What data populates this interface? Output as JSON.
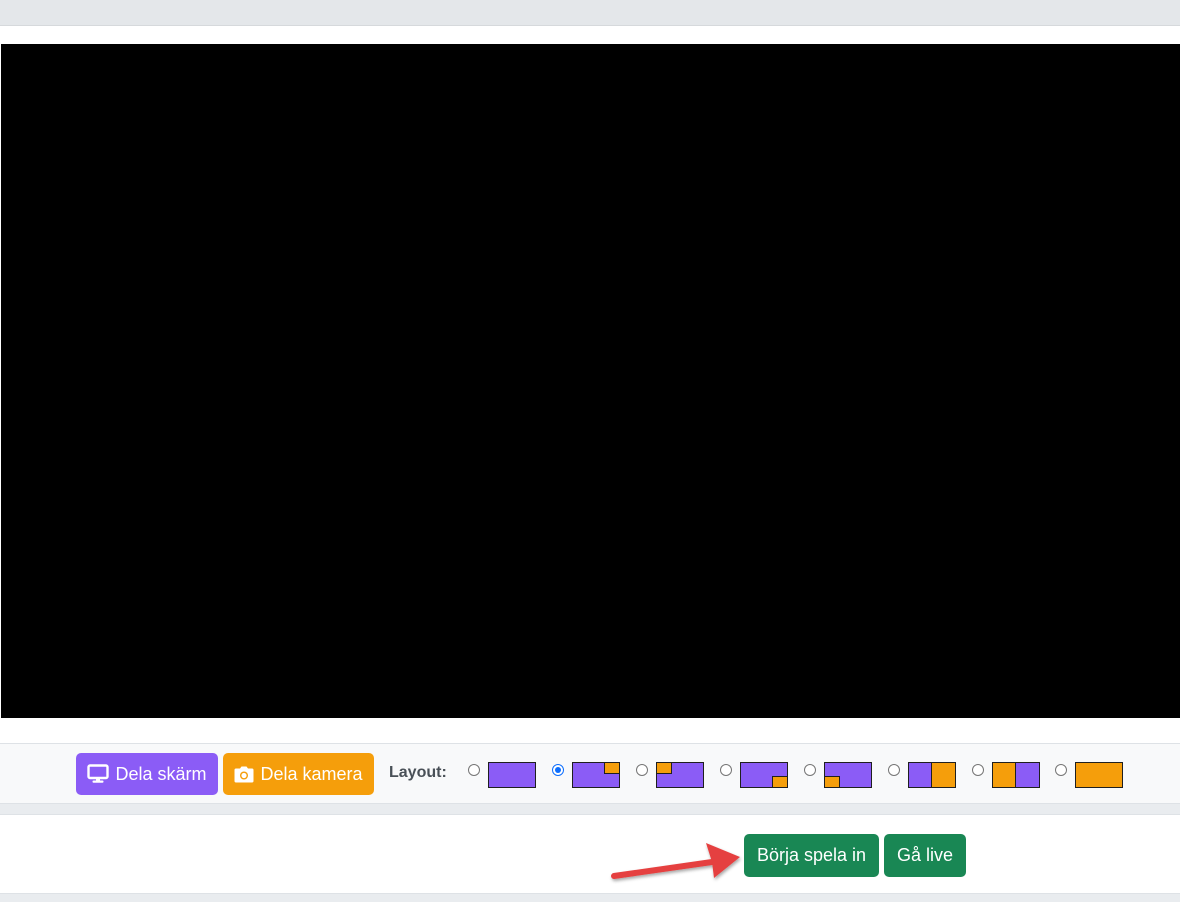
{
  "controls": {
    "share_screen_label": "Dela skärm",
    "share_camera_label": "Dela kamera",
    "layout_label": "Layout:",
    "layout_options": [
      {
        "id": "screen-only",
        "checked": false
      },
      {
        "id": "screen-camera-top-right",
        "checked": true
      },
      {
        "id": "screen-camera-top-left",
        "checked": false
      },
      {
        "id": "screen-camera-bottom-right",
        "checked": false
      },
      {
        "id": "screen-camera-bottom-left",
        "checked": false
      },
      {
        "id": "split-screen-left-camera-right",
        "checked": false
      },
      {
        "id": "split-camera-left-screen-right",
        "checked": false
      },
      {
        "id": "camera-only",
        "checked": false
      }
    ]
  },
  "actions": {
    "record_label": "Börja spela in",
    "live_label": "Gå live"
  },
  "colors": {
    "screen": "#8b5cf6",
    "camera": "#f59e0b",
    "action": "#198754",
    "annotation_arrow": "#e5413f"
  },
  "icons": {
    "share_screen": "monitor-icon",
    "share_camera": "camera-icon"
  }
}
